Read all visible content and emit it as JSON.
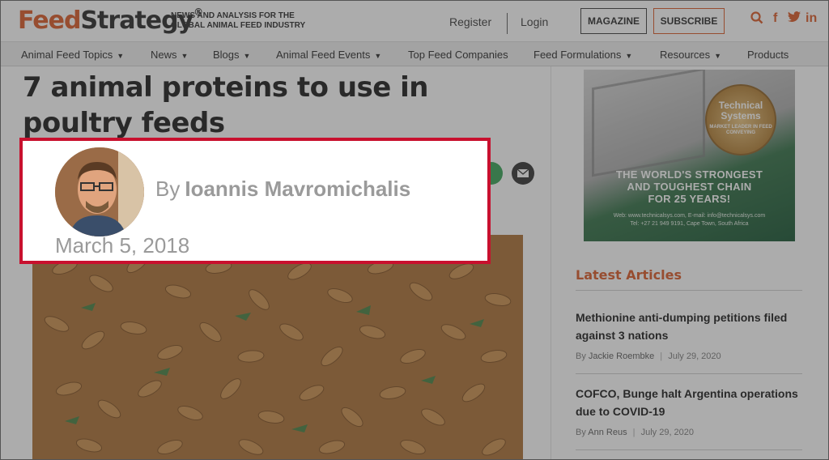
{
  "header": {
    "logo_part1": "Feed",
    "logo_part2": "Strategy",
    "logo_tm": "®",
    "tagline_line1": "NEWS AND ANALYSIS FOR THE",
    "tagline_line2": "GLOBAL ANIMAL FEED INDUSTRY",
    "register_label": "Register",
    "login_label": "Login",
    "magazine_label": "MAGAZINE",
    "subscribe_label": "SUBSCRIBE",
    "icons": [
      "search-icon",
      "facebook-icon",
      "twitter-icon",
      "linkedin-icon"
    ]
  },
  "nav": {
    "items": [
      {
        "label": "Animal Feed Topics",
        "dropdown": true
      },
      {
        "label": "News",
        "dropdown": true
      },
      {
        "label": "Blogs",
        "dropdown": true
      },
      {
        "label": "Animal Feed Events",
        "dropdown": true
      },
      {
        "label": "Top Feed Companies",
        "dropdown": false
      },
      {
        "label": "Feed Formulations",
        "dropdown": true
      },
      {
        "label": "Resources",
        "dropdown": true
      },
      {
        "label": "Products",
        "dropdown": false
      }
    ]
  },
  "article": {
    "title": "7 animal proteins to use in poultry feeds",
    "by_prefix": "By",
    "author": "Ioannis Mavromichalis",
    "date": "March 5, 2018",
    "share_icons": [
      "share-icon",
      "email-icon"
    ]
  },
  "ad": {
    "badge_line1": "Technical",
    "badge_line2": "Systems",
    "badge_small": "MARKET LEADER IN FEED CONVEYING",
    "headline_line1": "THE WORLD'S STRONGEST",
    "headline_line2": "AND TOUGHEST CHAIN",
    "headline_line3": "FOR 25 YEARS!",
    "contact_line1": "Web: www.technicalsys.com, E-mail: info@technicalsys.com",
    "contact_line2": "Tel: +27 21 949 9191, Cape Town, South Africa"
  },
  "latest": {
    "heading": "Latest Articles",
    "items": [
      {
        "title": "Methionine anti-dumping petitions filed against 3 nations",
        "by": "By",
        "author": "Jackie Roembke",
        "date": "July 29, 2020"
      },
      {
        "title": "COFCO, Bunge halt Argentina operations due to COVID-19",
        "by": "By",
        "author": "Ann Reus",
        "date": "July 29, 2020"
      }
    ]
  },
  "colors": {
    "brand_orange": "#d9531e",
    "highlight_red": "#c8102e",
    "overlay": "#464646"
  }
}
